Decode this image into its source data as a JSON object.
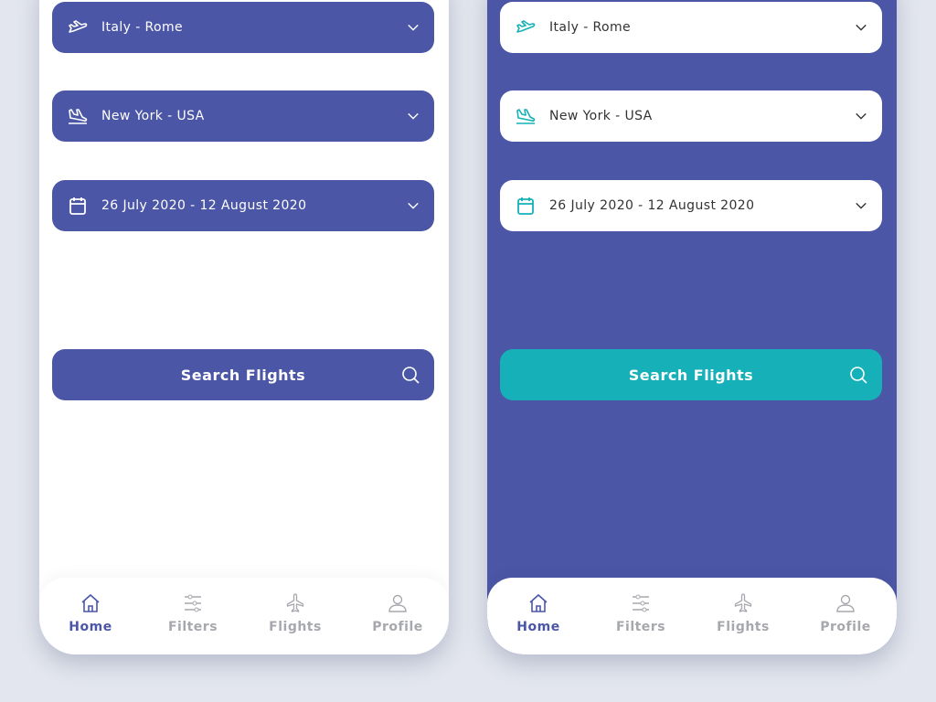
{
  "colors": {
    "primary": "#4b56a6",
    "accent": "#15b0b8",
    "background": "#e3e6ee"
  },
  "phones": [
    {
      "theme": "light",
      "fields": [
        {
          "icon": "plane-takeoff-icon",
          "label": "Italy - Rome"
        },
        {
          "icon": "plane-landing-icon",
          "label": "New York - USA"
        },
        {
          "icon": "calendar-icon",
          "label": "26 July 2020 - 12 August 2020"
        }
      ],
      "search_label": "Search Flights",
      "nav": [
        {
          "icon": "home-icon",
          "label": "Home",
          "active": true
        },
        {
          "icon": "sliders-icon",
          "label": "Filters"
        },
        {
          "icon": "airplane-icon",
          "label": "Flights"
        },
        {
          "icon": "user-icon",
          "label": "Profile"
        }
      ]
    },
    {
      "theme": "dark",
      "fields": [
        {
          "icon": "plane-takeoff-icon",
          "label": "Italy - Rome"
        },
        {
          "icon": "plane-landing-icon",
          "label": "New York - USA"
        },
        {
          "icon": "calendar-icon",
          "label": "26 July 2020 - 12 August 2020"
        }
      ],
      "search_label": "Search Flights",
      "nav": [
        {
          "icon": "home-icon",
          "label": "Home",
          "active": true
        },
        {
          "icon": "sliders-icon",
          "label": "Filters"
        },
        {
          "icon": "airplane-icon",
          "label": "Flights"
        },
        {
          "icon": "user-icon",
          "label": "Profile"
        }
      ]
    }
  ]
}
